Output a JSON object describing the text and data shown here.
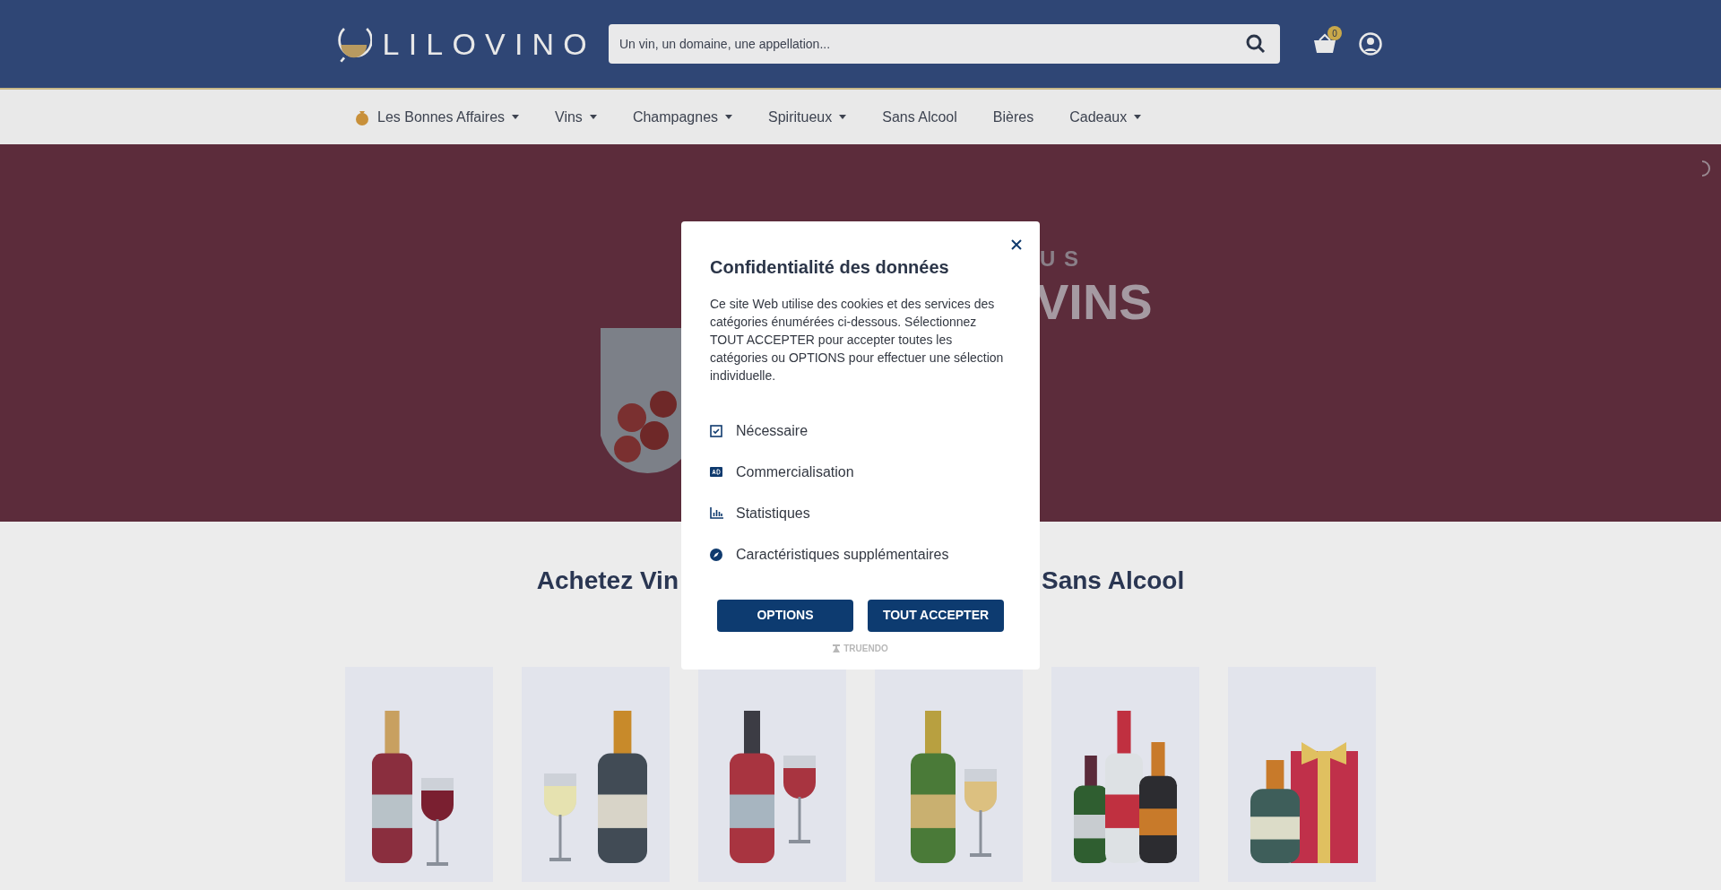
{
  "header": {
    "logo": "LILOVINO",
    "search": {
      "placeholder": "Un vin, un domaine, une appellation..."
    },
    "cart_count": "0"
  },
  "nav": [
    {
      "label": "Les Bonnes Affaires",
      "dropdown": true,
      "kind": "deals"
    },
    {
      "label": "Vins",
      "dropdown": true,
      "kind": "plain"
    },
    {
      "label": "Champagnes",
      "dropdown": true,
      "kind": "plain"
    },
    {
      "label": "Spiritueux",
      "dropdown": true,
      "kind": "plain"
    },
    {
      "label": "Sans Alcool",
      "dropdown": false,
      "kind": "plain"
    },
    {
      "label": "Bières",
      "dropdown": false,
      "kind": "plain"
    },
    {
      "label": "Cadeaux",
      "dropdown": true,
      "kind": "plain"
    }
  ],
  "hero": {
    "kicker": "US",
    "title": "VINS"
  },
  "section": {
    "heading_left": "Achetez Vin",
    "heading_right": "Sans Alcool"
  },
  "categories": [
    {
      "kind": "red_wine"
    },
    {
      "kind": "white_wine"
    },
    {
      "kind": "red_bottle"
    },
    {
      "kind": "champagne"
    },
    {
      "kind": "spirits"
    },
    {
      "kind": "gift"
    }
  ],
  "consent": {
    "title": "Confidentialité des données",
    "text": "Ce site Web utilise des cookies et des services des catégories énumérées ci-dessous. Sélectionnez TOUT ACCEPTER pour accepter toutes les catégories ou OPTIONS pour effectuer une sélection individuelle.",
    "items": [
      {
        "label": "Nécessaire",
        "kind": "check"
      },
      {
        "label": "Commercialisation",
        "kind": "ad"
      },
      {
        "label": "Statistiques",
        "kind": "chart"
      },
      {
        "label": "Caractéristiques supplémentaires",
        "kind": "compass"
      }
    ],
    "buttons": [
      "OPTIONS",
      "TOUT ACCEPTER"
    ],
    "powered_by": "TRUENDO"
  }
}
